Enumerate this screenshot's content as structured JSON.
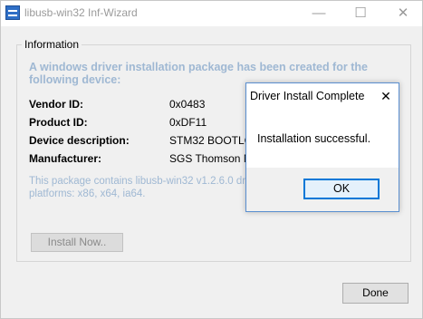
{
  "window": {
    "title": "libusb-win32 Inf-Wizard",
    "controls": {
      "minimize": "—",
      "maximize": "☐",
      "close": "✕"
    }
  },
  "information": {
    "group_label": "Information",
    "headline": "A windows driver installation package has been created for the following device:",
    "fields": [
      {
        "label": "Vendor ID:",
        "value": "0x0483"
      },
      {
        "label": "Product ID:",
        "value": "0xDF11"
      },
      {
        "label": "Device description:",
        "value": "STM32  BOOTLOA"
      },
      {
        "label": "Manufacturer:",
        "value": "SGS Thomson Micr"
      }
    ],
    "package_text_line1": "This package contains libusb-win32 v1.2.6.0 driver",
    "package_text_line2": "platforms: x86, x64, ia64."
  },
  "buttons": {
    "install_now": "Install Now..",
    "done": "Done"
  },
  "dialog": {
    "title": "Driver Install Complete",
    "close": "✕",
    "message": "Installation successful.",
    "ok": "OK"
  },
  "colors": {
    "dialog_border": "#5a8fd0",
    "ok_button_border": "#0078d7",
    "faded_text": "#9fb8d3"
  }
}
